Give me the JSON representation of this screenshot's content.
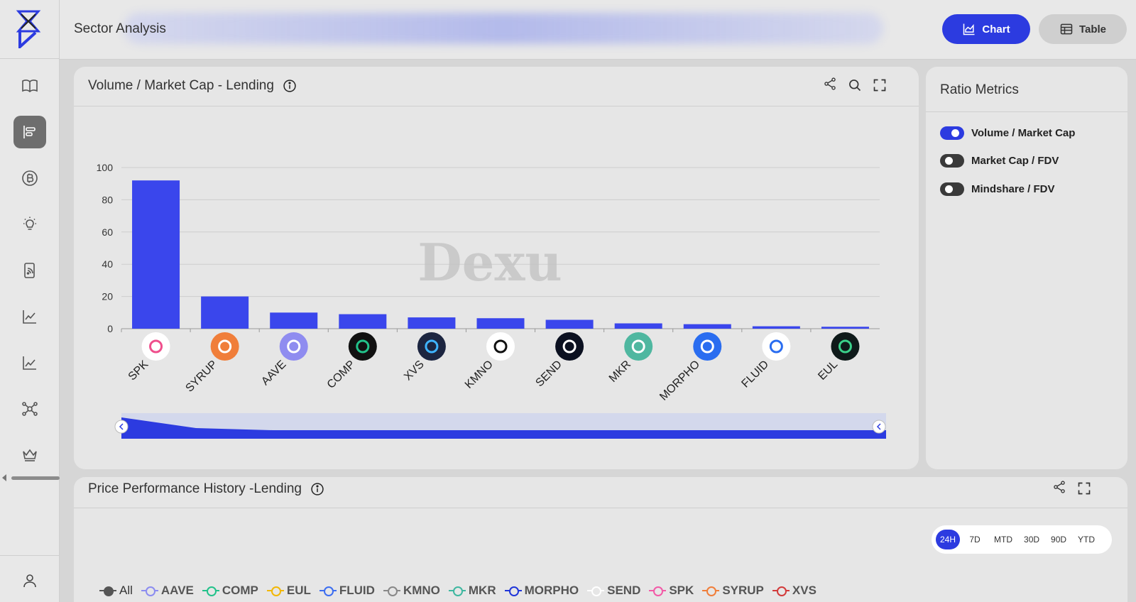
{
  "header": {
    "title": "Sector Analysis",
    "chart_button": "Chart",
    "table_button": "Table"
  },
  "volume_card": {
    "title": "Volume / Market Cap - Lending",
    "watermark": "Dexu"
  },
  "ratio_card": {
    "title": "Ratio Metrics",
    "toggles": [
      {
        "label": "Volume / Market Cap",
        "on": true
      },
      {
        "label": "Market Cap / FDV",
        "on": false
      },
      {
        "label": "Mindshare / FDV",
        "on": false
      }
    ]
  },
  "perf_card": {
    "title": "Price Performance History -Lending",
    "timeframes": [
      "24H",
      "7D",
      "MTD",
      "30D",
      "90D",
      "YTD"
    ],
    "active_timeframe": "24H",
    "legend": [
      {
        "label": "All",
        "color": "#555555"
      },
      {
        "label": "AAVE",
        "color": "#8b8cf0"
      },
      {
        "label": "COMP",
        "color": "#22c28a"
      },
      {
        "label": "EUL",
        "color": "#f2b705"
      },
      {
        "label": "FLUID",
        "color": "#3c6df0"
      },
      {
        "label": "KMNO",
        "color": "#888888"
      },
      {
        "label": "MKR",
        "color": "#3fb7a0"
      },
      {
        "label": "MORPHO",
        "color": "#2036d9"
      },
      {
        "label": "SEND",
        "color": "#ffffff"
      },
      {
        "label": "SPK",
        "color": "#f25aa7"
      },
      {
        "label": "SYRUP",
        "color": "#f07e3a"
      },
      {
        "label": "XVS",
        "color": "#d23a3a"
      }
    ]
  },
  "colors": {
    "accent": "#2c3be0",
    "bar": "#3a46ec"
  },
  "chart_data": {
    "type": "bar",
    "title": "Volume / Market Cap - Lending",
    "categories": [
      "SPK",
      "SYRUP",
      "AAVE",
      "COMP",
      "XVS",
      "KMNO",
      "SEND",
      "MKR",
      "MORPHO",
      "FLUID",
      "EUL"
    ],
    "values": [
      92,
      20,
      10,
      9,
      7,
      6.5,
      5.5,
      3.3,
      2.8,
      1.5,
      1.2
    ],
    "yticks": [
      0,
      20,
      40,
      60,
      80,
      100
    ],
    "ylim": [
      0,
      100
    ],
    "grid": true,
    "xlabel": "",
    "ylabel": ""
  }
}
